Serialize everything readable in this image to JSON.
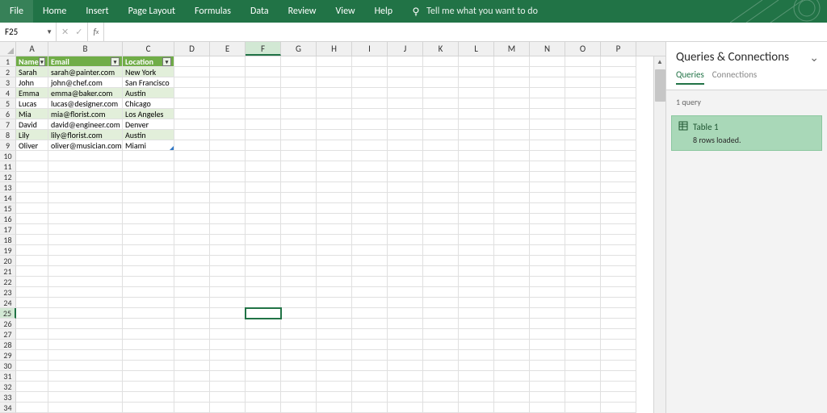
{
  "ribbon": {
    "tabs": [
      "File",
      "Home",
      "Insert",
      "Page Layout",
      "Formulas",
      "Data",
      "Review",
      "View",
      "Help"
    ],
    "tellme": "Tell me what you want to do"
  },
  "namebox": "F25",
  "formula": "",
  "columns": {
    "widths": {
      "A": 40,
      "B": 92,
      "C": 64,
      "default": 44
    },
    "letters": [
      "A",
      "B",
      "C",
      "D",
      "E",
      "F",
      "G",
      "H",
      "I",
      "J",
      "K",
      "L",
      "M",
      "N",
      "O",
      "P"
    ]
  },
  "table": {
    "headers": [
      "Name",
      "Email",
      "Location"
    ],
    "rows": [
      [
        "Sarah",
        "sarah@painter.com",
        "New York"
      ],
      [
        "John",
        "john@chef.com",
        "San Francisco"
      ],
      [
        "Emma",
        "emma@baker.com",
        "Austin"
      ],
      [
        "Lucas",
        "lucas@designer.com",
        "Chicago"
      ],
      [
        "Mia",
        "mia@florist.com",
        "Los Angeles"
      ],
      [
        "David",
        "david@engineer.com",
        "Denver"
      ],
      [
        "Lily",
        "lily@florist.com",
        "Austin"
      ],
      [
        "Oliver",
        "oliver@musician.com",
        "Miami"
      ]
    ]
  },
  "activeCell": {
    "col": "F",
    "row": 25
  },
  "rowsVisible": 34,
  "panel": {
    "title": "Queries & Connections",
    "tabs": [
      "Queries",
      "Connections"
    ],
    "activeTab": "Queries",
    "meta": "1 query",
    "query": {
      "name": "Table 1",
      "status": "8 rows loaded."
    }
  },
  "chart_data": {
    "type": "table",
    "headers": [
      "Name",
      "Email",
      "Location"
    ],
    "rows": [
      [
        "Sarah",
        "sarah@painter.com",
        "New York"
      ],
      [
        "John",
        "john@chef.com",
        "San Francisco"
      ],
      [
        "Emma",
        "emma@baker.com",
        "Austin"
      ],
      [
        "Lucas",
        "lucas@designer.com",
        "Chicago"
      ],
      [
        "Mia",
        "mia@florist.com",
        "Los Angeles"
      ],
      [
        "David",
        "david@engineer.com",
        "Denver"
      ],
      [
        "Lily",
        "lily@florist.com",
        "Austin"
      ],
      [
        "Oliver",
        "oliver@musician.com",
        "Miami"
      ]
    ]
  }
}
